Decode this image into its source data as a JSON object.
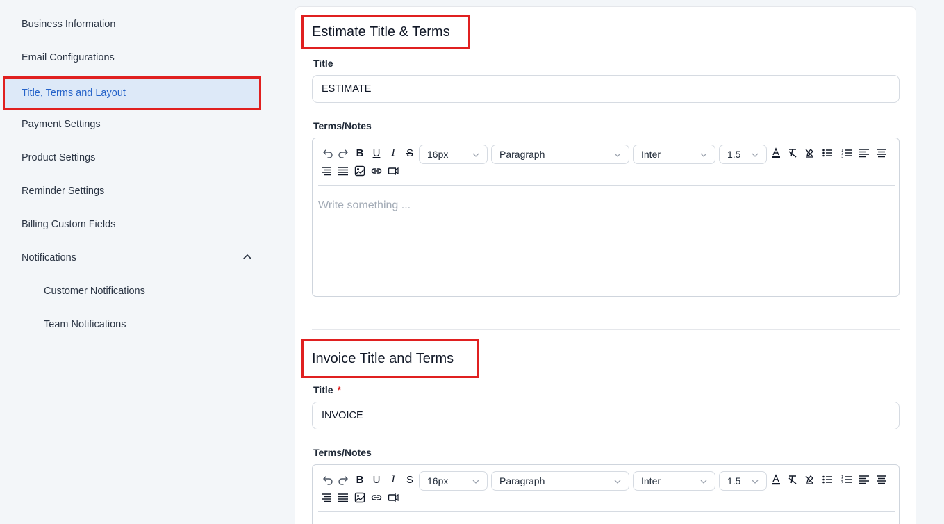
{
  "sidebar": {
    "items": [
      {
        "label": "Business Information"
      },
      {
        "label": "Email Configurations"
      },
      {
        "label": "Title, Terms and Layout"
      },
      {
        "label": "Payment Settings"
      },
      {
        "label": "Product Settings"
      },
      {
        "label": "Reminder Settings"
      },
      {
        "label": "Billing Custom Fields"
      },
      {
        "label": "Notifications"
      },
      {
        "label": "Customer Notifications"
      },
      {
        "label": "Team Notifications"
      }
    ],
    "active_item": "Title, Terms and Layout"
  },
  "estimate": {
    "heading": "Estimate Title & Terms",
    "title_label": "Title",
    "title_value": "ESTIMATE",
    "terms_label": "Terms/Notes",
    "placeholder": "Write something ..."
  },
  "invoice": {
    "heading": "Invoice Title and Terms",
    "title_label": "Title",
    "required_mark": "*",
    "title_value": "INVOICE",
    "terms_label": "Terms/Notes"
  },
  "toolbar": {
    "font_size": "16px",
    "block_type": "Paragraph",
    "font_family": "Inter",
    "line_height": "1.5",
    "icons": [
      "undo-icon",
      "redo-icon",
      "bold-icon",
      "underline-icon",
      "italic-icon",
      "strikethrough-icon",
      "font-color-icon",
      "clear-format-icon",
      "highlight-icon",
      "bullet-list-icon",
      "numbered-list-icon",
      "align-left-icon",
      "align-center-icon",
      "align-right-icon",
      "align-justify-icon",
      "image-icon",
      "link-icon",
      "embed-icon"
    ]
  },
  "colors": {
    "highlight_border": "#e02020",
    "active_bg": "#dde9f8",
    "active_text": "#2563c9"
  }
}
